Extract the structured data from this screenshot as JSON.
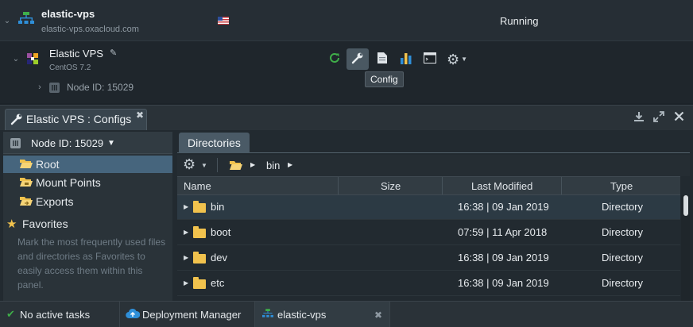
{
  "environment": {
    "name": "elastic-vps",
    "domain": "elastic-vps.oxacloud.com",
    "status": "Running"
  },
  "node": {
    "name": "Elastic VPS",
    "os": "CentOS 7.2",
    "node_id_label": "Node ID: 15029",
    "tooltip": "Config"
  },
  "toolbar_icons": [
    "restart-icon",
    "config-wrench-icon",
    "log-file-icon",
    "statistics-icon",
    "web-ssh-icon",
    "settings-gear-icon"
  ],
  "panel": {
    "tab_title": "Elastic VPS : Configs",
    "node_select": "Node ID: 15029",
    "tree": [
      {
        "label": "Root",
        "selected": true
      },
      {
        "label": "Mount Points",
        "selected": false
      },
      {
        "label": "Exports",
        "selected": false
      }
    ],
    "favorites": {
      "title": "Favorites",
      "description": "Mark the most frequently used files and directories as Favorites to easily access them within this panel."
    },
    "dir_tab": "Directories",
    "breadcrumb": [
      "bin"
    ],
    "columns": [
      "Name",
      "Size",
      "Last Modified",
      "Type"
    ],
    "files": [
      {
        "name": "bin",
        "size": "",
        "modified": "16:38 | 09 Jan 2019",
        "type": "Directory"
      },
      {
        "name": "boot",
        "size": "",
        "modified": "07:59 | 11 Apr 2018",
        "type": "Directory"
      },
      {
        "name": "dev",
        "size": "",
        "modified": "16:38 | 09 Jan 2019",
        "type": "Directory"
      },
      {
        "name": "etc",
        "size": "",
        "modified": "16:38 | 09 Jan 2019",
        "type": "Directory"
      }
    ]
  },
  "bottom_bar": {
    "tasks": "No active tasks",
    "deployment": "Deployment Manager",
    "env_tab": "elastic-vps"
  },
  "colors": {
    "accent_green": "#3fae49",
    "accent_blue": "#2f8fd8",
    "folder_yellow": "#f1c24d",
    "selection": "#46657d"
  }
}
